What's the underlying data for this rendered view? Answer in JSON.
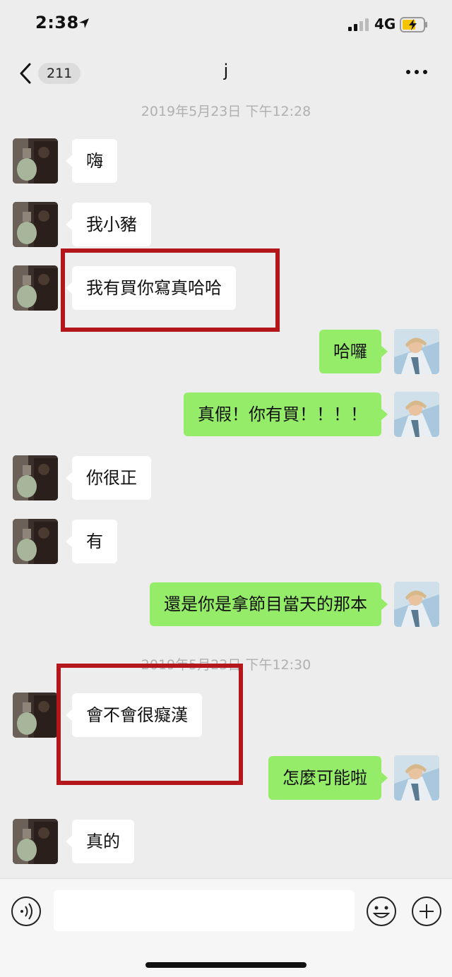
{
  "status_bar": {
    "time": "2:38",
    "network": "4G"
  },
  "nav": {
    "unread_count": "211",
    "title": "j"
  },
  "timestamps": [
    "2019年5月23日 下午12:28",
    "2019年5月23日 下午12:30"
  ],
  "messages": [
    {
      "from": "them",
      "text": "嗨"
    },
    {
      "from": "them",
      "text": "我小豬"
    },
    {
      "from": "them",
      "text": "我有買你寫真哈哈"
    },
    {
      "from": "me",
      "text": "哈囉"
    },
    {
      "from": "me",
      "text": "真假！你有買！！！！"
    },
    {
      "from": "them",
      "text": "你很正"
    },
    {
      "from": "them",
      "text": "有"
    },
    {
      "from": "me",
      "text": "還是你是拿節目當天的那本"
    },
    {
      "from": "them",
      "text": "會不會很癡漢"
    },
    {
      "from": "me",
      "text": "怎麼可能啦"
    },
    {
      "from": "them",
      "text": "真的"
    }
  ],
  "input": {
    "placeholder": ""
  },
  "colors": {
    "background": "#ededed",
    "outgoing_bubble": "#95ec69",
    "incoming_bubble": "#ffffff",
    "highlight": "#b3161b"
  }
}
